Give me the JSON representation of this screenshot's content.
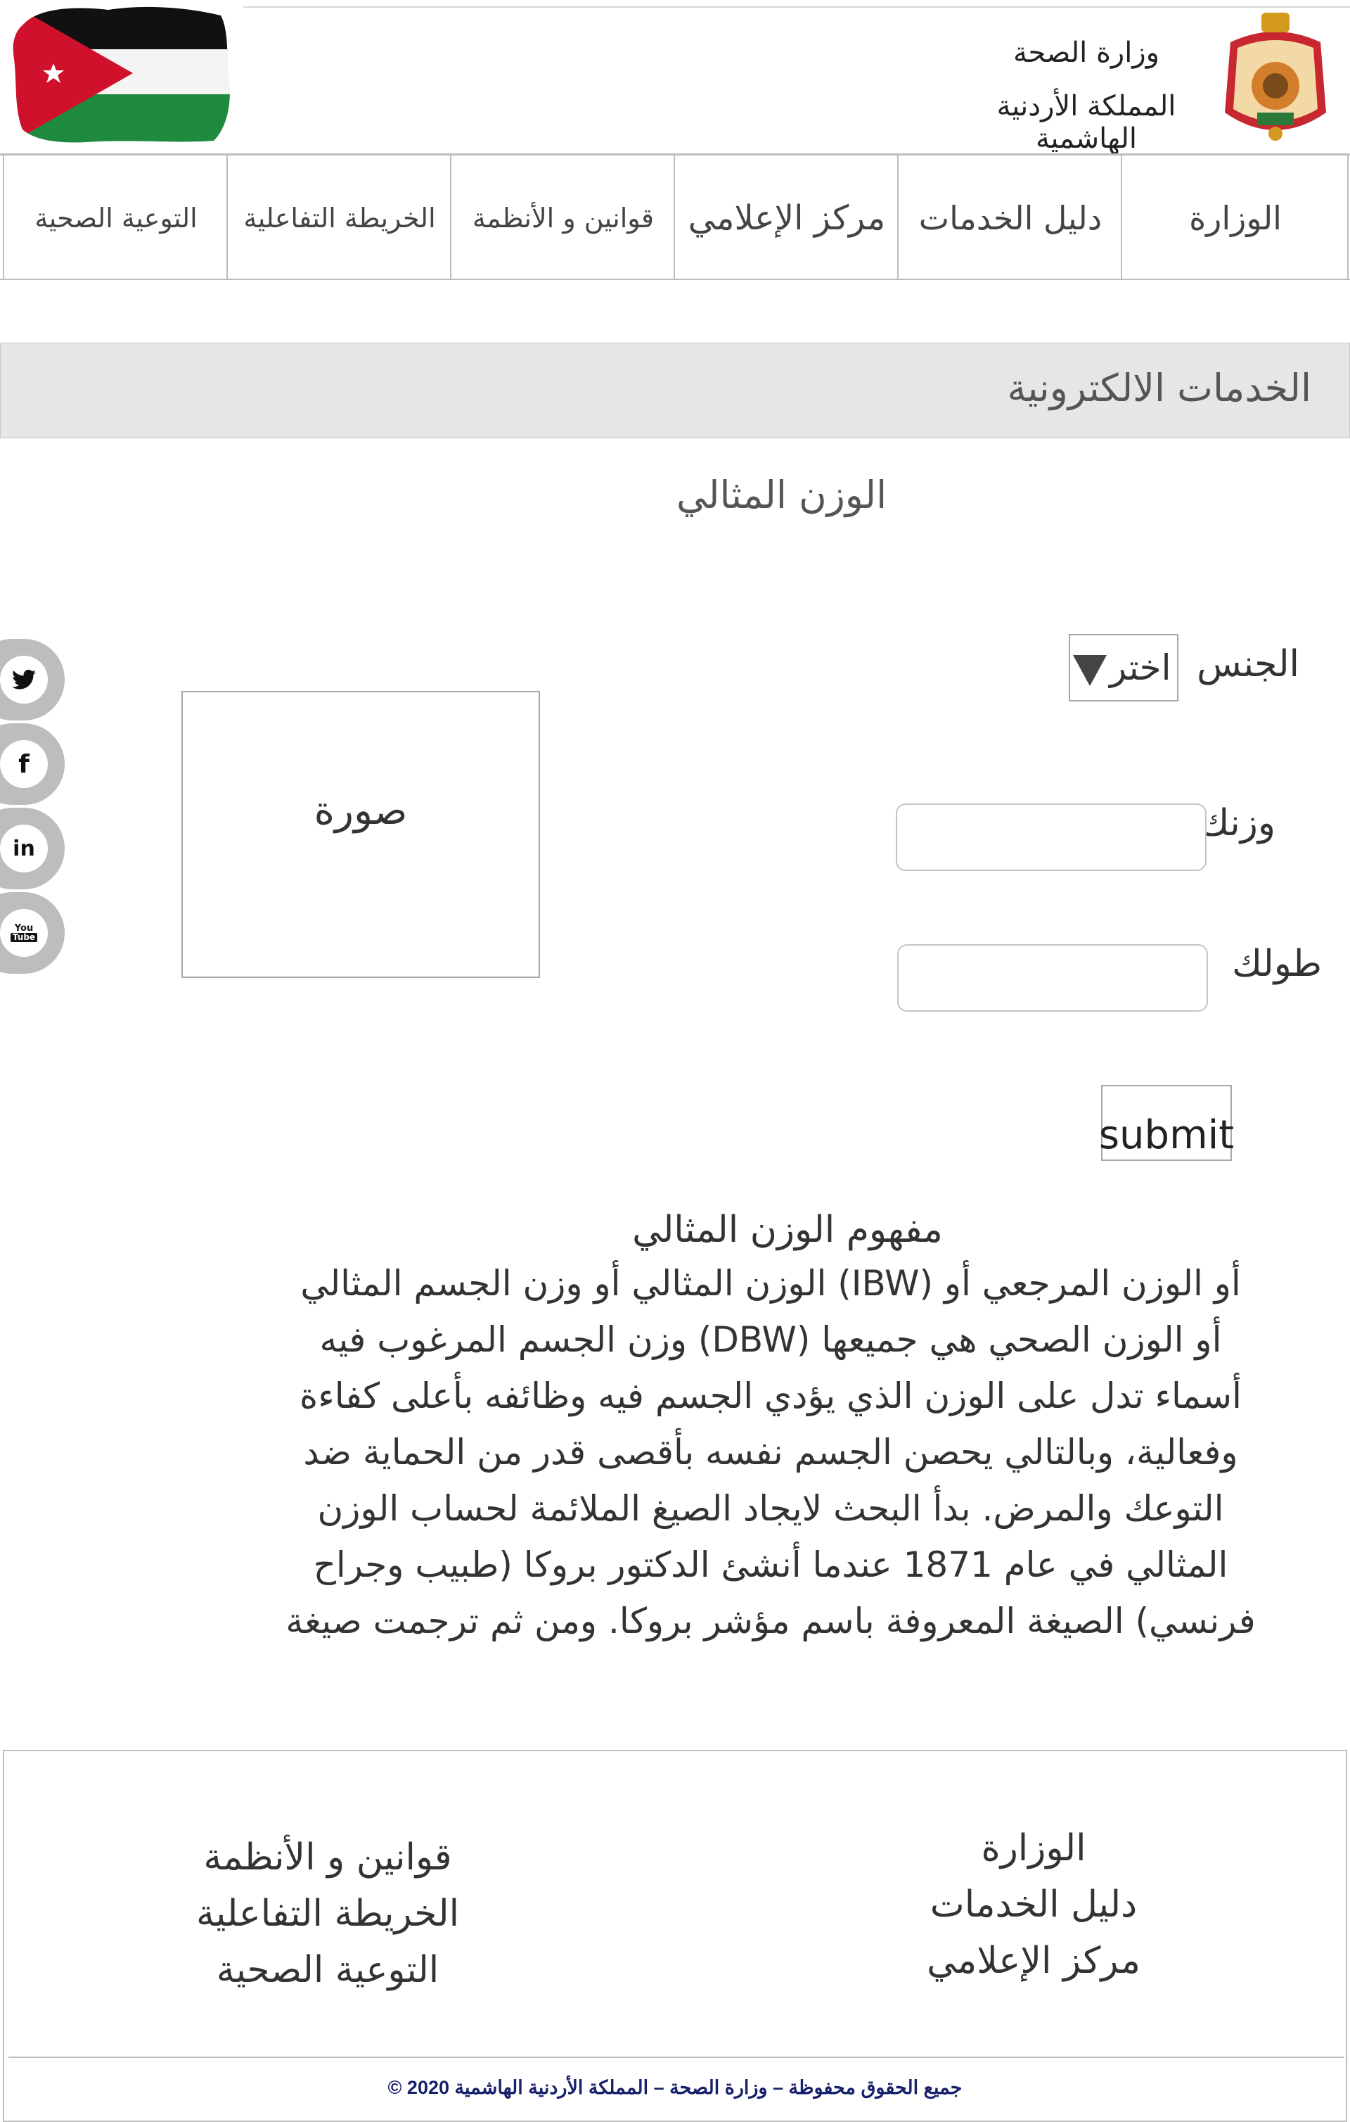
{
  "header": {
    "ministry_line1": "وزارة الصحة",
    "ministry_line2": "المملكة الأردنية الهاشمية"
  },
  "nav": {
    "items": [
      {
        "label": "الوزارة"
      },
      {
        "label": "دليل الخدمات"
      },
      {
        "label": "مركز الإعلامي"
      },
      {
        "label": "قوانين و الأنظمة"
      },
      {
        "label": "الخريطة التفاعلية"
      },
      {
        "label": "التوعية الصحية"
      }
    ]
  },
  "section": {
    "title": "الخدمات الالكترونية"
  },
  "page": {
    "title": "الوزن المثالي"
  },
  "form": {
    "gender_label": "الجنس",
    "gender_select_value": "اختر",
    "weight_label": "وزنك",
    "weight_value": "",
    "height_label": "طولك",
    "height_value": "",
    "submit_label": "submit"
  },
  "image_placeholder": {
    "label": "صورة"
  },
  "social": {
    "items": [
      {
        "icon": "twitter-icon",
        "glyph": "🐦"
      },
      {
        "icon": "facebook-icon",
        "glyph": "f"
      },
      {
        "icon": "linkedin-icon",
        "glyph": "in"
      },
      {
        "icon": "youtube-icon",
        "glyph": "You Tube"
      }
    ]
  },
  "article": {
    "title": "مفهوم الوزن المثالي",
    "lines": [
      "أو الوزن المرجعي أو (IBW) الوزن المثالي أو وزن الجسم المثالي",
      "أو الوزن الصحي هي جميعها (DBW) وزن الجسم المرغوب فيه",
      "أسماء تدل على الوزن الذي يؤدي الجسم فيه وظائفه بأعلى كفاءة",
      "وفعالية، وبالتالي يحصن الجسم نفسه بأقصى قدر من الحماية ضد",
      "التوعك والمرض. بدأ البحث لايجاد الصيغ الملائمة لحساب الوزن",
      "المثالي في عام 1871 عندما أنشئ الدكتور بروكا (طبيب وجراح",
      "فرنسي) الصيغة المعروفة باسم مؤشر بروكا. ومن ثم ترجمت صيغة"
    ]
  },
  "footer": {
    "right_links": [
      "الوزارة",
      "دليل الخدمات",
      "مركز الإعلامي"
    ],
    "left_links": [
      "قوانين و الأنظمة",
      "الخريطة التفاعلية",
      "التوعية الصحية"
    ],
    "copyright": "جميع الحقوق محفوظة – وزارة الصحة – المملكة الأردنية الهاشمية 2020 ©"
  },
  "colors": {
    "flag_red": "#ce1126",
    "flag_green": "#007a3d",
    "flag_black": "#000000",
    "copyright_text": "#16206b",
    "section_bar": "#e6e6e6"
  }
}
